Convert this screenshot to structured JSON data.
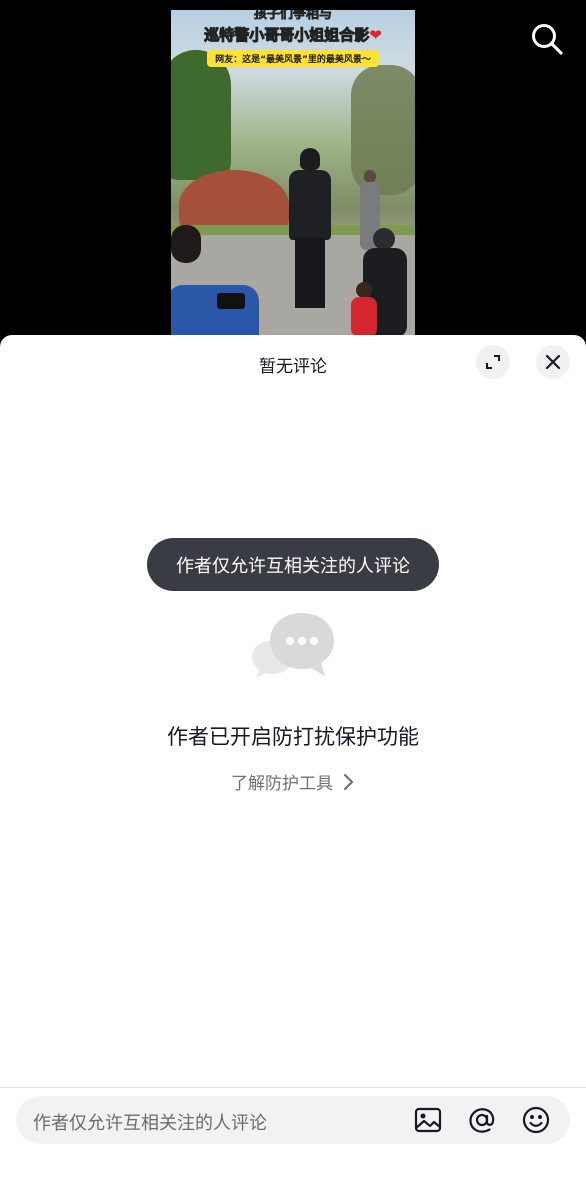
{
  "video": {
    "title_line1": "孩子们争相与",
    "title_line2": "巡特警小哥哥小姐姐合影",
    "title_heart": "❤",
    "caption": "网友：这是“最美风景”里的最美风景～"
  },
  "header": {
    "search_icon": "search-icon"
  },
  "sheet": {
    "title": "暂无评论",
    "expand_icon": "expand-icon",
    "close_icon": "close-icon",
    "toast": "作者仅允许互相关注的人评论",
    "empty_icon": "chat-bubbles-icon",
    "empty_heading": "作者已开启防打扰保护功能",
    "learn_link": "了解防护工具"
  },
  "input": {
    "placeholder": "作者仅允许互相关注的人评论",
    "icons": [
      "image-icon",
      "at-icon",
      "emoji-icon"
    ]
  },
  "colors": {
    "toast_bg": "#3a3c43",
    "sheet_bg": "#ffffff",
    "input_bg": "#f2f2f3",
    "text_primary": "#161823",
    "text_secondary": "#6f7076"
  }
}
